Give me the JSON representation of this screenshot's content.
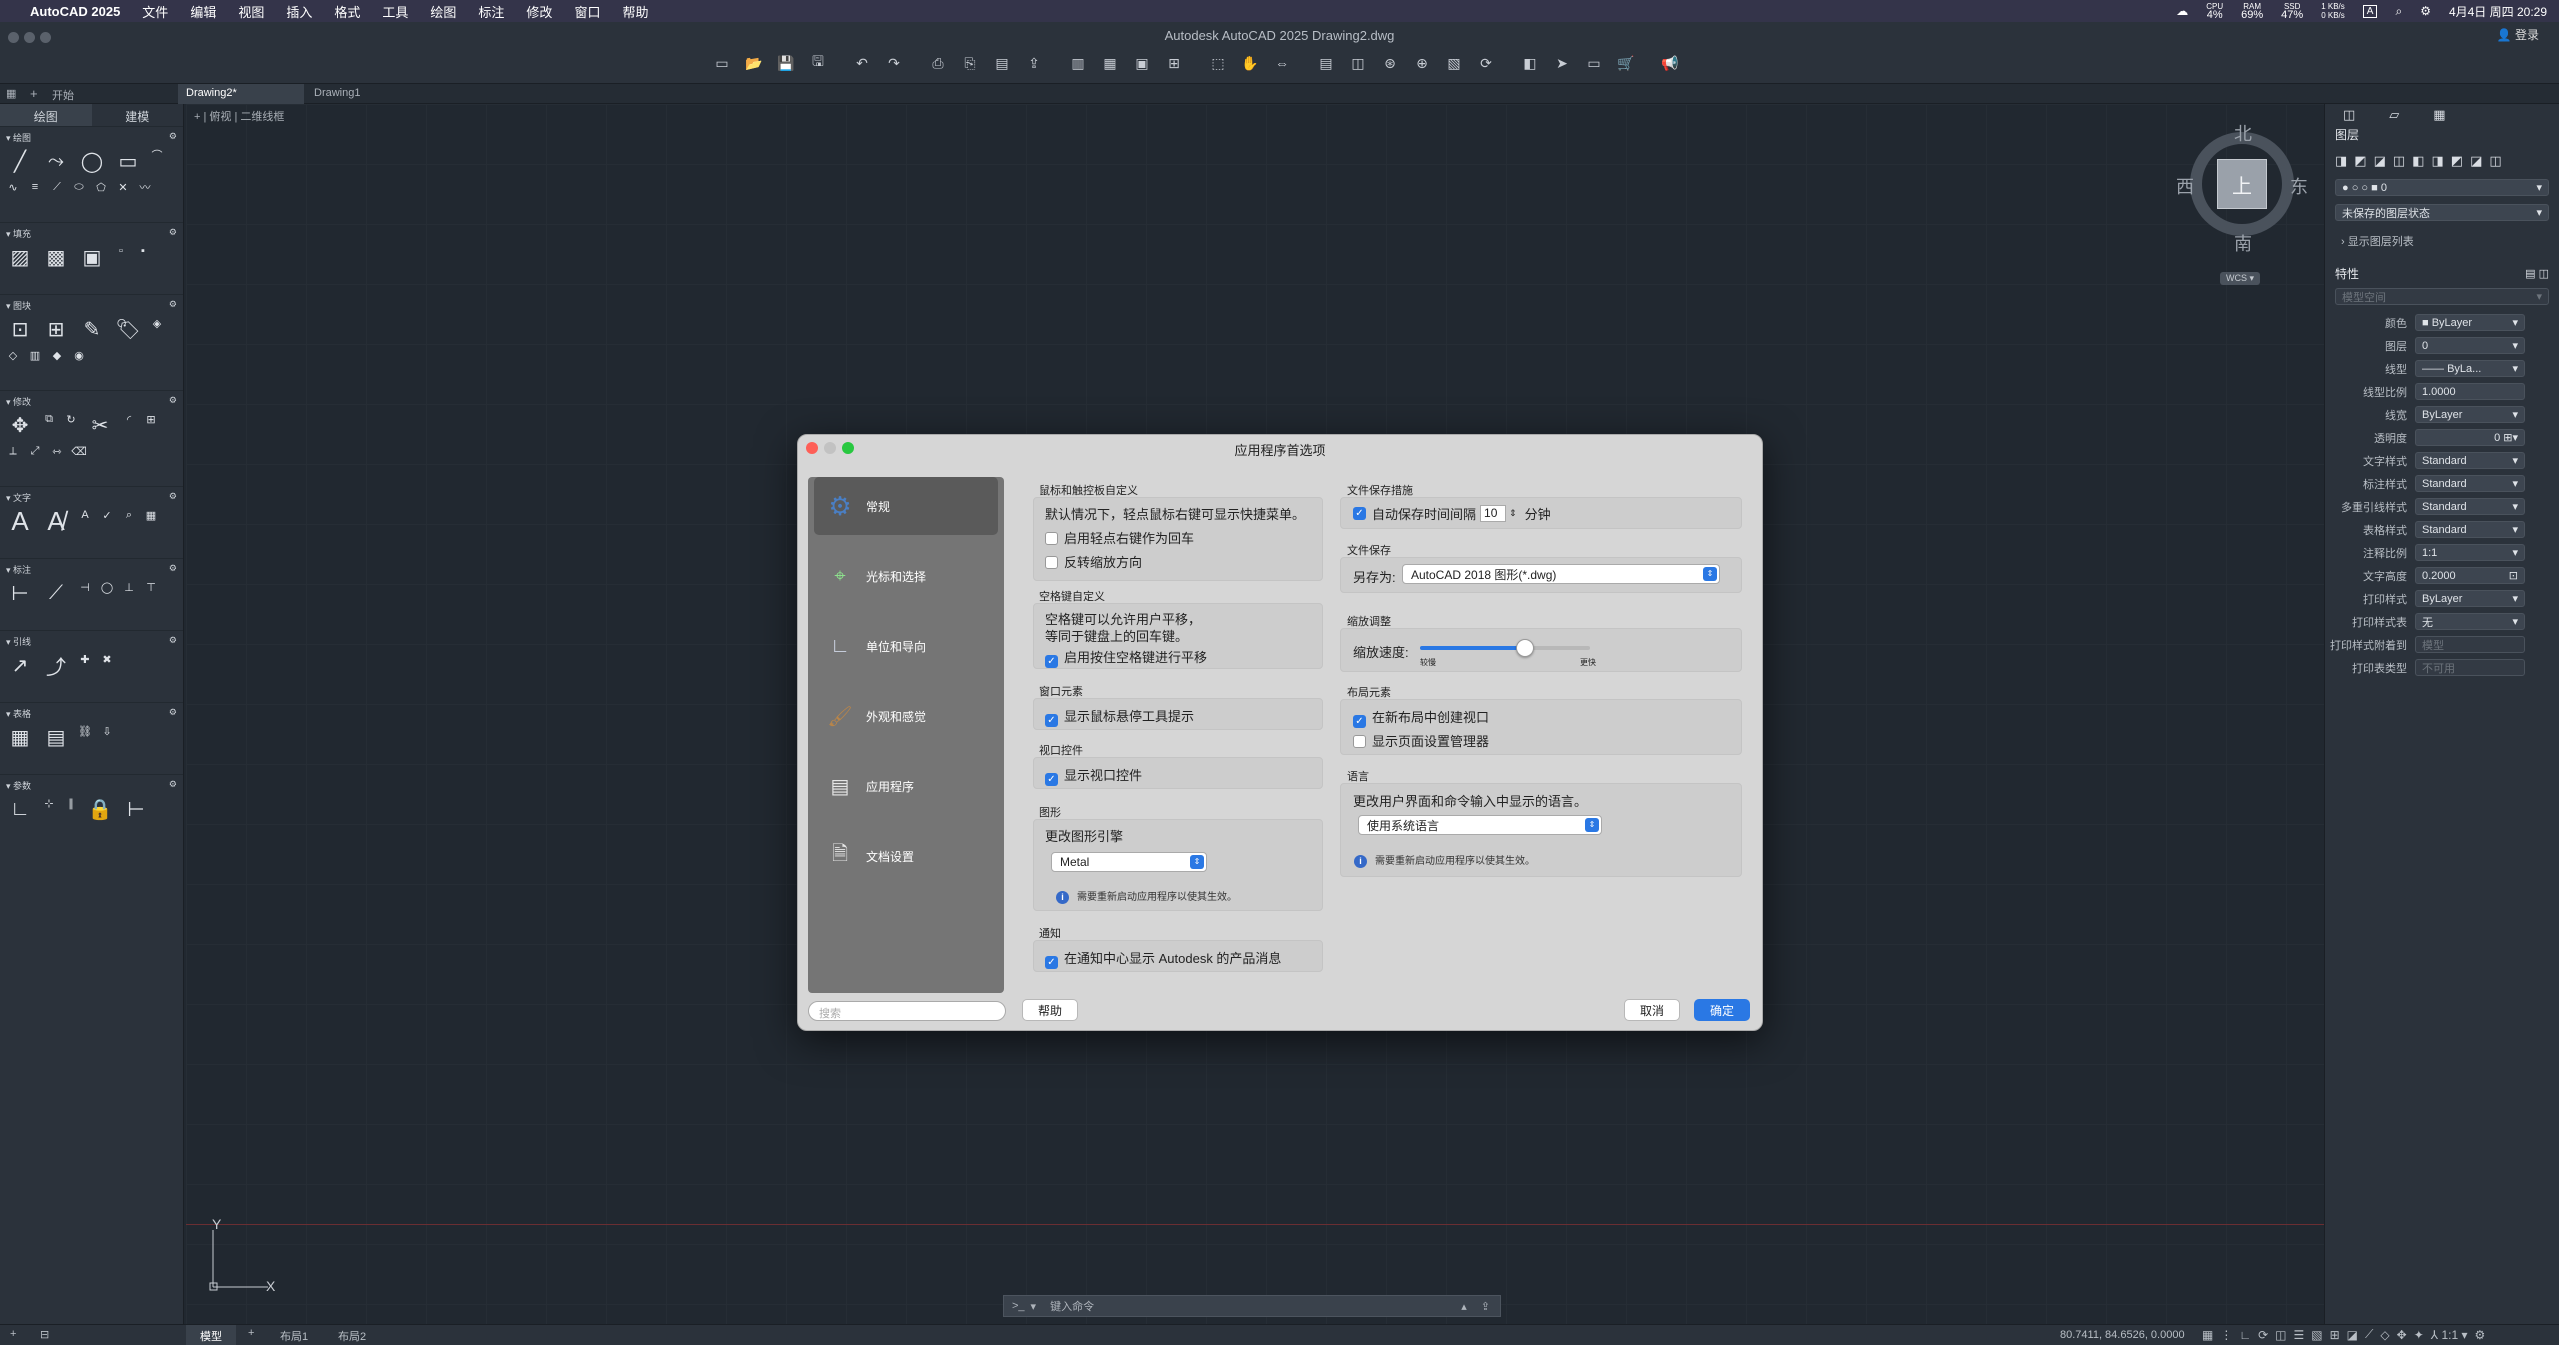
{
  "menubar": {
    "app": "AutoCAD 2025",
    "items": [
      "文件",
      "编辑",
      "视图",
      "插入",
      "格式",
      "工具",
      "绘图",
      "标注",
      "修改",
      "窗口",
      "帮助"
    ],
    "cpu_label": "CPU",
    "cpu_value": "4%",
    "ram_label": "RAM",
    "ram_value": "69%",
    "ssd_label": "SSD",
    "ssd_value": "47%",
    "net_up": "1 KB/s",
    "net_down": "0 KB/s",
    "input": "A",
    "datetime": "4月4日 周四 20:29"
  },
  "titlebar": {
    "title": "Autodesk AutoCAD 2025    Drawing2.dwg",
    "user": "登录"
  },
  "tabs": {
    "start": "开始",
    "doc1": "Drawing2*",
    "doc2": "Drawing1"
  },
  "leftpanel": {
    "tab_draw": "绘图",
    "tab_model": "建模",
    "sections": [
      "绘图",
      "填充",
      "图块",
      "修改",
      "文字",
      "标注",
      "引线",
      "表格",
      "参数"
    ]
  },
  "canvas": {
    "view_label": "+ | 俯视 | 二维线框",
    "ucs_y": "Y",
    "ucs_x": "X"
  },
  "viewcube": {
    "top": "上",
    "north": "北",
    "south": "南",
    "east": "东",
    "west": "西",
    "wcs": "WCS"
  },
  "command": {
    "prompt": ">_",
    "placeholder": "键入命令"
  },
  "rightpanel": {
    "layers_title": "图层",
    "layer_value": "0",
    "layer_state": "未保存的图层状态",
    "layer_list": "显示图层列表",
    "properties_title": "特性",
    "space": "模型空间",
    "props": [
      {
        "label": "颜色",
        "value": "ByLayer"
      },
      {
        "label": "图层",
        "value": "0"
      },
      {
        "label": "线型",
        "value": "ByLa..."
      },
      {
        "label": "线型比例",
        "value": "1.0000"
      },
      {
        "label": "线宽",
        "value": "ByLayer"
      },
      {
        "label": "透明度",
        "value": "0"
      },
      {
        "label": "文字样式",
        "value": "Standard"
      },
      {
        "label": "标注样式",
        "value": "Standard"
      },
      {
        "label": "多重引线样式",
        "value": "Standard"
      },
      {
        "label": "表格样式",
        "value": "Standard"
      },
      {
        "label": "注释比例",
        "value": "1:1"
      },
      {
        "label": "文字高度",
        "value": "0.2000"
      },
      {
        "label": "打印样式",
        "value": "ByLayer"
      },
      {
        "label": "打印样式表",
        "value": "无"
      },
      {
        "label": "打印样式附着到",
        "value": "模型"
      },
      {
        "label": "打印表类型",
        "value": "不可用"
      }
    ]
  },
  "statusbar": {
    "model": "模型",
    "layout1": "布局1",
    "layout2": "布局2",
    "coords": "80.7411, 84.6526, 0.0000",
    "scale": "1:1"
  },
  "dialog": {
    "title": "应用程序首选项",
    "sidebar": [
      "常规",
      "光标和选择",
      "单位和导向",
      "外观和感觉",
      "应用程序",
      "文档设置"
    ],
    "search_placeholder": "搜索",
    "help": "帮助",
    "cancel": "取消",
    "ok": "确定",
    "mouse_title": "鼠标和触控板自定义",
    "mouse_desc": "默认情况下，轻点鼠标右键可显示快捷菜单。",
    "mouse_opt1": "启用轻点右键作为回车",
    "mouse_opt2": "反转缩放方向",
    "space_title": "空格键自定义",
    "space_desc1": "空格键可以允许用户平移，",
    "space_desc2": "等同于键盘上的回车键。",
    "space_opt": "启用按住空格键进行平移",
    "window_title": "窗口元素",
    "window_opt": "显示鼠标悬停工具提示",
    "viewport_title": "视口控件",
    "viewport_opt": "显示视口控件",
    "graphics_title": "图形",
    "graphics_desc": "更改图形引擎",
    "graphics_value": "Metal",
    "graphics_note": "需要重新启动应用程序以使其生效。",
    "notify_title": "通知",
    "notify_opt": "在通知中心显示 Autodesk 的产品消息",
    "save_title": "文件保存措施",
    "autosave_prefix": "自动保存时间间隔",
    "autosave_value": "10",
    "autosave_unit": "分钟",
    "filesave_title": "文件保存",
    "saveas_label": "另存为:",
    "saveas_value": "AutoCAD 2018 图形(*.dwg)",
    "zoom_title": "缩放调整",
    "zoom_label": "缩放速度:",
    "zoom_slow": "较慢",
    "zoom_fast": "更快",
    "zoom_level": 0.62,
    "layout_title": "布局元素",
    "layout_opt1": "在新布局中创建视口",
    "layout_opt2": "显示页面设置管理器",
    "lang_title": "语言",
    "lang_desc": "更改用户界面和命令输入中显示的语言。",
    "lang_value": "使用系统语言",
    "lang_note": "需要重新启动应用程序以使其生效。"
  }
}
